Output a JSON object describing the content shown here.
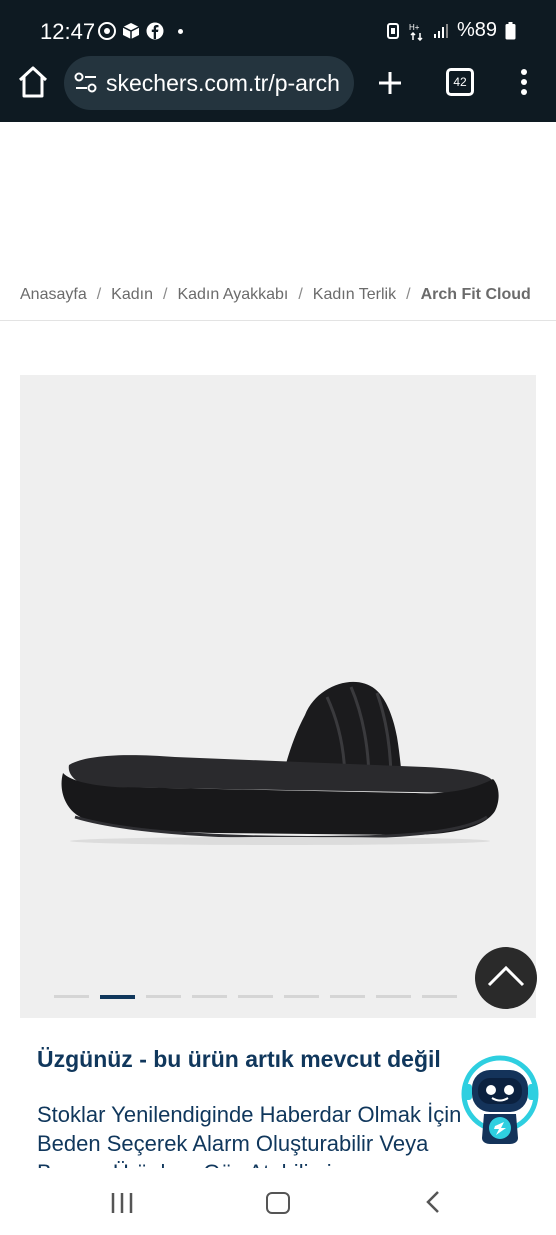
{
  "status_bar": {
    "time": "12:47",
    "battery": "%89",
    "icons": [
      "chrome-icon",
      "box-icon",
      "facebook-icon",
      "notification-dot",
      "vibrate-icon",
      "data-icon",
      "signal-icon",
      "battery-icon"
    ]
  },
  "browser": {
    "url": "skechers.com.tr/p-arch",
    "tab_count": "42"
  },
  "breadcrumb": {
    "items": [
      "Anasayfa",
      "Kadın",
      "Kadın Ayakkabı",
      "Kadın Terlik"
    ],
    "current": "Arch Fit Cloud",
    "separator": "/"
  },
  "gallery": {
    "slide_count": 10,
    "active_slide": 2
  },
  "product": {
    "unavailable_title": "Üzgünüz - bu ürün artık mevcut değil",
    "description": "Stoklar Yenilendiginde Haberdar Olmak İçin Beden Seçerek Alarm Oluşturabilir Veya Benzer Ürünlere Göz Atabilirsin"
  },
  "colors": {
    "brand_navy": "#10375c",
    "status_bar": "#0e1a22",
    "gallery_bg": "#efefef"
  }
}
